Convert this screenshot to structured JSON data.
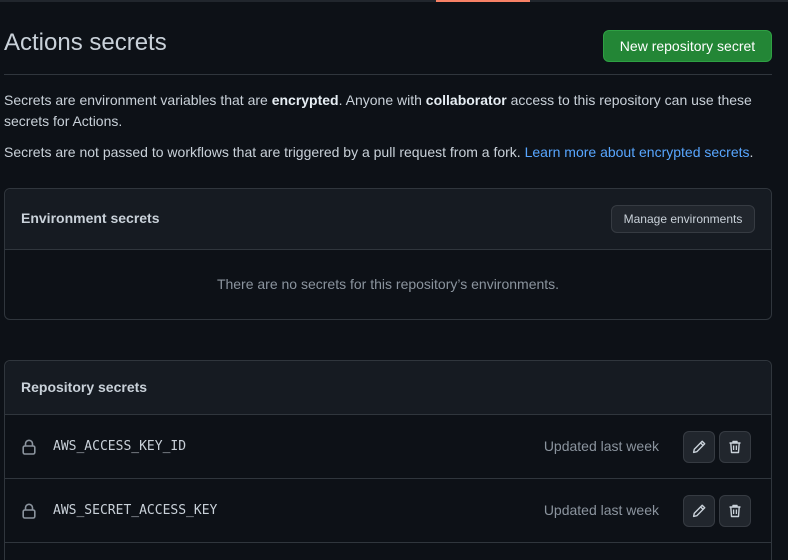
{
  "header": {
    "title": "Actions secrets",
    "new_secret_label": "New repository secret"
  },
  "description": {
    "line1_a": "Secrets are environment variables that are ",
    "line1_b": "encrypted",
    "line1_c": ". Anyone with ",
    "line1_d": "collaborator",
    "line1_e": " access to this repository can use these secrets for Actions.",
    "line2_text": "Secrets are not passed to workflows that are triggered by a pull request from a fork. ",
    "line2_link": "Learn more about encrypted secrets",
    "line2_end": "."
  },
  "environment_secrets": {
    "title": "Environment secrets",
    "manage_label": "Manage environments",
    "empty_message": "There are no secrets for this repository’s environments."
  },
  "repository_secrets": {
    "title": "Repository secrets",
    "items": [
      {
        "name": "AWS_ACCESS_KEY_ID",
        "updated": "Updated last week"
      },
      {
        "name": "AWS_SECRET_ACCESS_KEY",
        "updated": "Updated last week"
      }
    ]
  },
  "icons": {
    "secret": "lock-icon",
    "edit": "pencil-icon",
    "delete": "trash-icon"
  },
  "colors": {
    "background": "#0d1117",
    "primary_button": "#238636",
    "link": "#58a6ff",
    "tab_accent": "#f78166"
  }
}
